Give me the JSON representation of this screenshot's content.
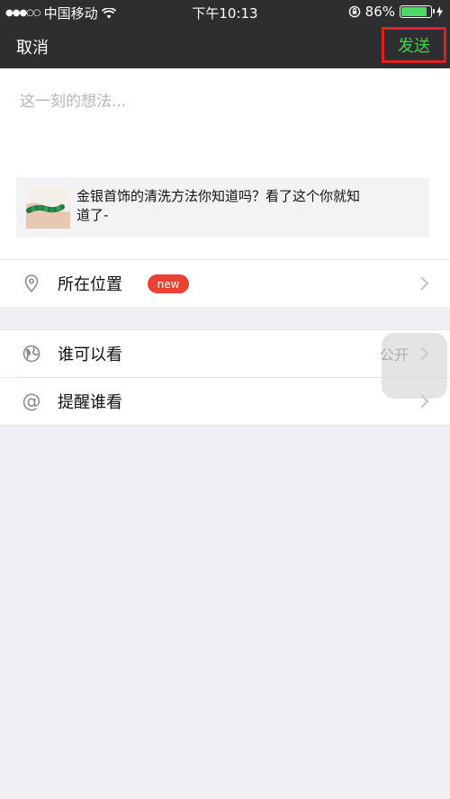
{
  "status_bar": {
    "signal": "●●●○○",
    "carrier": "中国移动",
    "time": "下午10:13",
    "battery_percent": "86%",
    "battery_level": 0.86
  },
  "nav": {
    "cancel": "取消",
    "send": "发送",
    "send_color": "#3dd34a",
    "highlight_color": "#e0201e"
  },
  "compose": {
    "placeholder": "这一刻的想法...",
    "link_card": {
      "title": "金银首饰的清洗方法你知道吗？看了这个你就知道了-"
    }
  },
  "options": {
    "location": {
      "label": "所在位置",
      "badge": "new",
      "icon": "location-pin-icon"
    },
    "visibility": {
      "label": "谁可以看",
      "value": "公开",
      "icon": "globe-icon"
    },
    "mention": {
      "label": "提醒谁看",
      "icon": "at-icon",
      "glyph": "@"
    }
  }
}
